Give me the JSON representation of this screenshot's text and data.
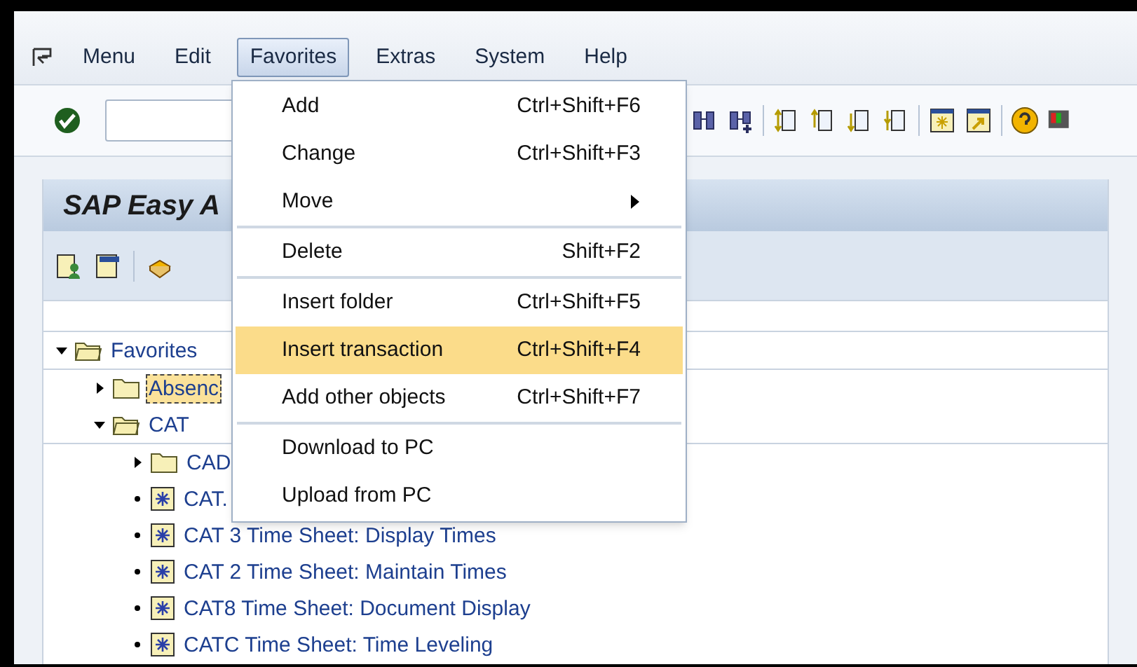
{
  "menu_bar": [
    {
      "label": "Menu",
      "selected": false
    },
    {
      "label": "Edit",
      "selected": false
    },
    {
      "label": "Favorites",
      "selected": true
    },
    {
      "label": "Extras",
      "selected": false
    },
    {
      "label": "System",
      "selected": false
    },
    {
      "label": "Help",
      "selected": false
    }
  ],
  "title": "SAP Easy A",
  "tree": [
    {
      "label": "Favorites",
      "kind": "folder",
      "expanded": true,
      "children": [
        {
          "label": "Absenc",
          "kind": "folder",
          "expanded": false,
          "selected": true
        },
        {
          "label": "CAT",
          "kind": "folder",
          "expanded": true,
          "selected": false,
          "children": [
            {
              "label": "CAD",
              "kind": "folder",
              "expanded": false,
              "selected": false
            },
            {
              "label": "CAT.",
              "kind": "transaction",
              "selected": false
            },
            {
              "label": "CAT 3 Time Sheet: Display Times",
              "kind": "transaction",
              "selected": false
            },
            {
              "label": "CAT 2 Time Sheet: Maintain Times",
              "kind": "transaction",
              "selected": false
            },
            {
              "label": "CAT8 Time Sheet: Document Display",
              "kind": "transaction",
              "selected": false
            },
            {
              "label": "CATC Time Sheet: Time Leveling",
              "kind": "transaction",
              "selected": false
            }
          ]
        }
      ]
    }
  ],
  "dropdown": [
    {
      "kind": "item",
      "label": "Add",
      "shortcut": "Ctrl+Shift+F6",
      "selected": false
    },
    {
      "kind": "item",
      "label": "Change",
      "shortcut": "Ctrl+Shift+F3",
      "selected": false
    },
    {
      "kind": "submenu",
      "label": "Move",
      "selected": false
    },
    {
      "kind": "separator"
    },
    {
      "kind": "item",
      "label": "Delete",
      "shortcut": "Shift+F2",
      "selected": false
    },
    {
      "kind": "separator"
    },
    {
      "kind": "item",
      "label": "Insert folder",
      "shortcut": "Ctrl+Shift+F5",
      "selected": false
    },
    {
      "kind": "item",
      "label": "Insert transaction",
      "shortcut": "Ctrl+Shift+F4",
      "selected": true
    },
    {
      "kind": "item",
      "label": "Add other objects",
      "shortcut": "Ctrl+Shift+F7",
      "selected": false
    },
    {
      "kind": "separator"
    },
    {
      "kind": "item",
      "label": "Download to PC",
      "selected": false
    },
    {
      "kind": "item",
      "label": "Upload from PC",
      "selected": false
    }
  ]
}
